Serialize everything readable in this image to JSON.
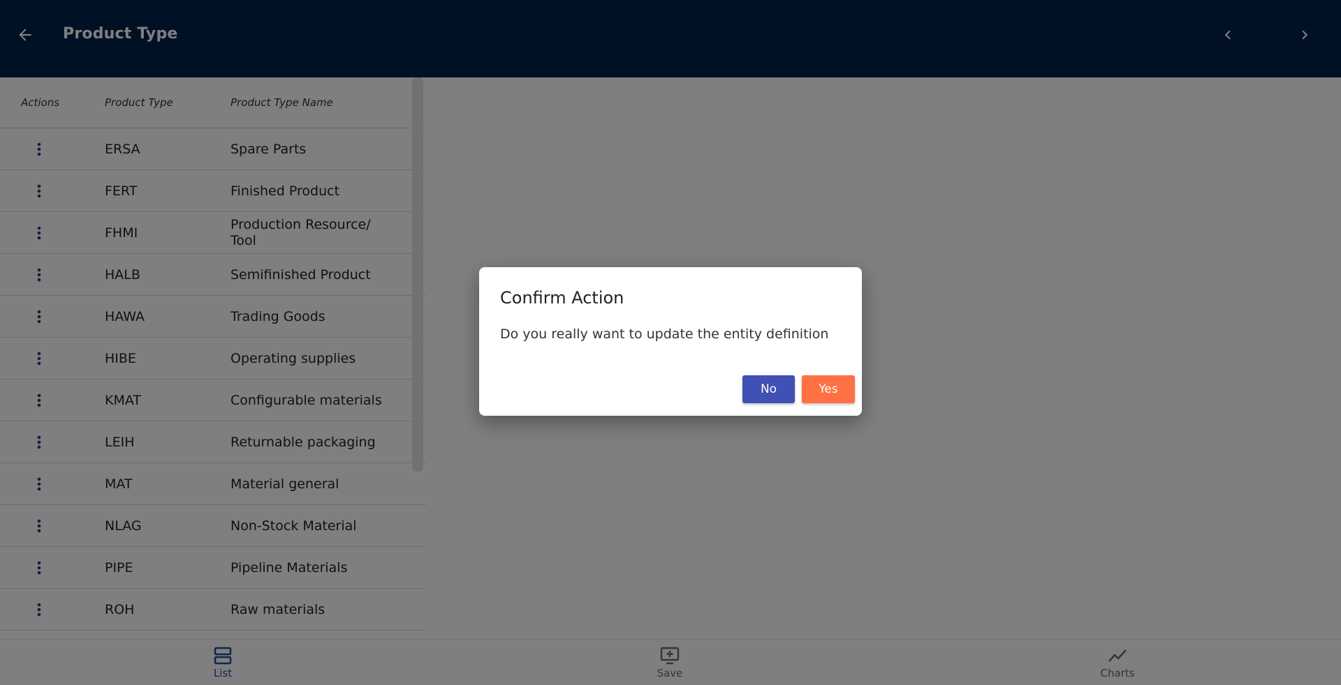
{
  "header": {
    "title": "Product Type",
    "back_icon": "arrow-left-icon",
    "prev_icon": "chevron-left-icon",
    "next_icon": "chevron-right-icon"
  },
  "table": {
    "columns": [
      "Actions",
      "Product Type",
      "Product Type Name"
    ],
    "rows": [
      {
        "type": "ERSA",
        "name": "Spare Parts"
      },
      {
        "type": "FERT",
        "name": "Finished Product"
      },
      {
        "type": "FHMI",
        "name": "Production Resource/ Tool"
      },
      {
        "type": "HALB",
        "name": "Semifinished Product"
      },
      {
        "type": "HAWA",
        "name": "Trading Goods"
      },
      {
        "type": "HIBE",
        "name": "Operating supplies"
      },
      {
        "type": "KMAT",
        "name": "Configurable materials"
      },
      {
        "type": "LEIH",
        "name": "Returnable packaging"
      },
      {
        "type": "MAT",
        "name": "Material general"
      },
      {
        "type": "NLAG",
        "name": "Non-Stock Material"
      },
      {
        "type": "PIPE",
        "name": "Pipeline Materials"
      },
      {
        "type": "ROH",
        "name": "Raw materials"
      }
    ]
  },
  "bottom_nav": {
    "list_label": "List",
    "save_label": "Save",
    "charts_label": "Charts"
  },
  "dialog": {
    "title": "Confirm Action",
    "message": "Do you really want to update the entity definition",
    "no_label": "No",
    "yes_label": "Yes"
  },
  "colors": {
    "header_bg": "#00214a",
    "no_button": "#3f51b5",
    "yes_button": "#ff7043",
    "active_nav": "#1f4e9c"
  }
}
